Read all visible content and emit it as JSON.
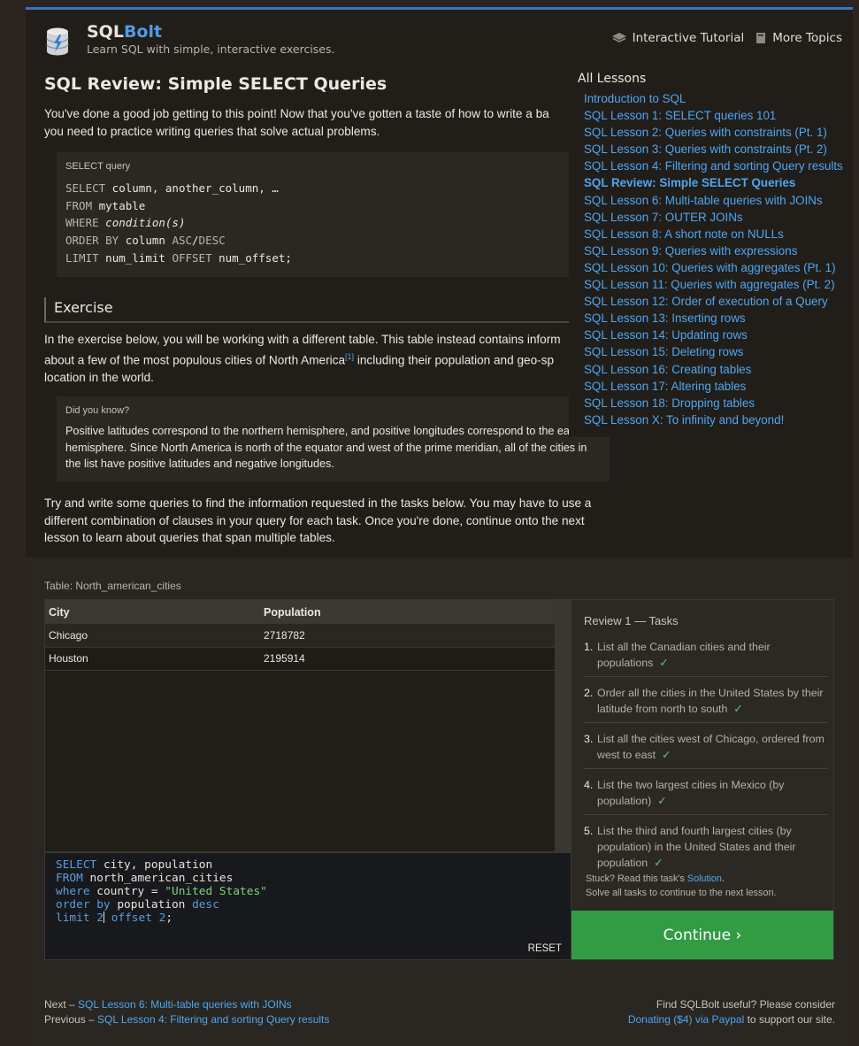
{
  "header": {
    "brand_sql": "SQL",
    "brand_bolt": "Bolt",
    "tagline": "Learn SQL with simple, interactive exercises.",
    "nav_tutorial": "Interactive Tutorial",
    "nav_more": "More Topics"
  },
  "lesson": {
    "title": "SQL Review: Simple SELECT Queries",
    "intro": "You've done a good job getting to this point! Now that you've gotten a taste of how to write a ba",
    "intro2": "you need to practice writing queries that solve actual problems.",
    "code_caption": "SELECT query",
    "exercise_heading": "Exercise",
    "exercise_p1": "In the exercise below, you will be working with a different table. This table instead contains inform",
    "exercise_p2": "about a few of the most populous cities of North America",
    "footnote": "[1]",
    "exercise_p3": " including their population and geo-sp",
    "exercise_p4": "location in the world.",
    "didyou_caption": "Did you know?",
    "didyou_text": "Positive latitudes correspond to the northern hemisphere, and positive longitudes correspond to the eastern hemisphere. Since North America is north of the equator and west of the prime meridian, all of the cities in the list have positive latitudes and negative longitudes.",
    "try_text": "Try and write some queries to find the information requested in the tasks below. You may have to use a different combination of clauses in your query for each task. Once you're done, continue onto the next lesson to learn about queries that span multiple tables."
  },
  "lessons_menu": {
    "heading": "All Lessons",
    "items": [
      "Introduction to SQL",
      "SQL Lesson 1: SELECT queries 101",
      "SQL Lesson 2: Queries with constraints (Pt. 1)",
      "SQL Lesson 3: Queries with constraints (Pt. 2)",
      "SQL Lesson 4: Filtering and sorting Query results",
      "SQL Review: Simple SELECT Queries",
      "SQL Lesson 6: Multi-table queries with JOINs",
      "SQL Lesson 7: OUTER JOINs",
      "SQL Lesson 8: A short note on NULLs",
      "SQL Lesson 9: Queries with expressions",
      "SQL Lesson 10: Queries with aggregates (Pt. 1)",
      "SQL Lesson 11: Queries with aggregates (Pt. 2)",
      "SQL Lesson 12: Order of execution of a Query",
      "SQL Lesson 13: Inserting rows",
      "SQL Lesson 14: Updating rows",
      "SQL Lesson 15: Deleting rows",
      "SQL Lesson 16: Creating tables",
      "SQL Lesson 17: Altering tables",
      "SQL Lesson 18: Dropping tables",
      "SQL Lesson X: To infinity and beyond!"
    ]
  },
  "table": {
    "caption": "Table: North_american_cities",
    "headers": [
      "City",
      "Population"
    ],
    "rows": [
      [
        "Chicago",
        "2718782"
      ],
      [
        "Houston",
        "2195914"
      ]
    ]
  },
  "editor": {
    "reset_label": "RESET"
  },
  "tasks": {
    "heading": "Review 1 — Tasks",
    "items": [
      "List all the Canadian cities and their populations",
      "Order all the cities in the United States by their latitude from north to south",
      "List all the cities west of Chicago, ordered from west to east",
      "List the two largest cities in Mexico (by population)",
      "List the third and fourth largest cities (by population) in the United States and their population"
    ],
    "check": "✓",
    "stuck_prefix": "Stuck? Read this task's ",
    "stuck_link": "Solution",
    "stuck_suffix": ".",
    "solve_all": "Solve all tasks to continue to the next lesson.",
    "continue_label": "Continue ›"
  },
  "footer": {
    "next_prefix": "Next – ",
    "next_link": "SQL Lesson 6: Multi-table queries with JOINs",
    "prev_prefix": "Previous – ",
    "prev_link": "SQL Lesson 4: Filtering and sorting Query results",
    "useful": "Find SQLBolt useful? Please consider",
    "donate_link": "Donating ($4) via Paypal",
    "donate_suffix": " to support our site."
  }
}
